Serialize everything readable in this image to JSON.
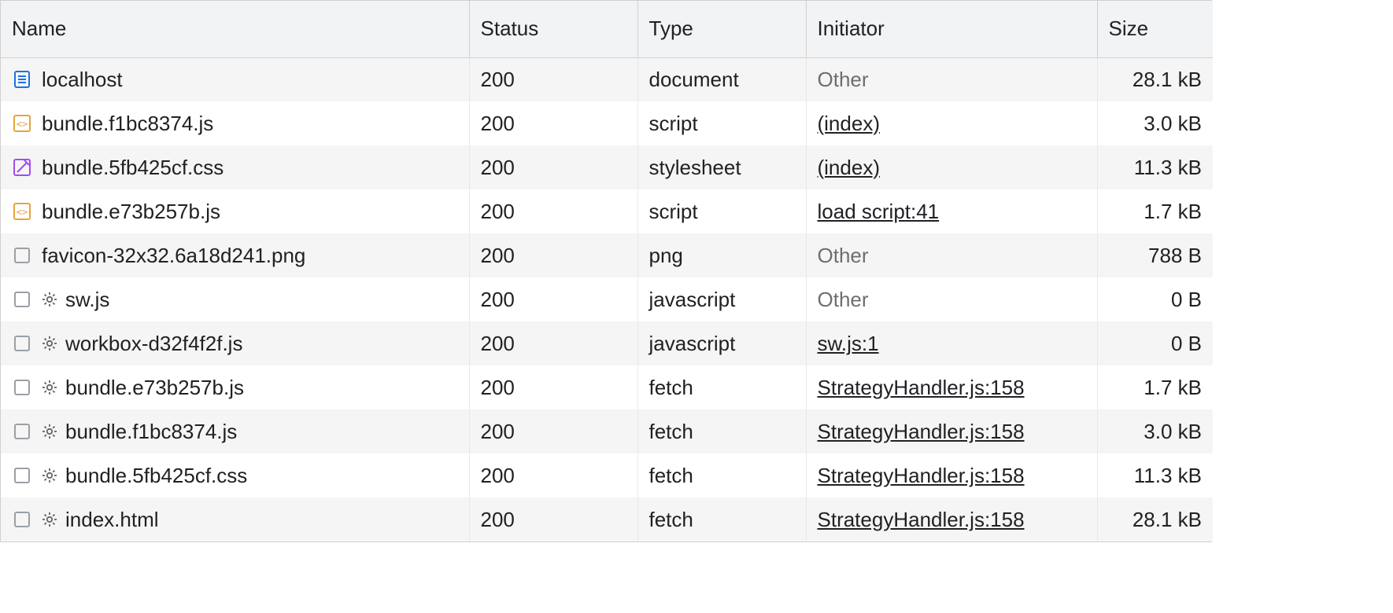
{
  "columns": {
    "name": "Name",
    "status": "Status",
    "type": "Type",
    "initiator": "Initiator",
    "size": "Size"
  },
  "rows": [
    {
      "icon": "document",
      "gear": false,
      "name": "localhost",
      "status": "200",
      "type": "document",
      "initiator": "Other",
      "initiator_link": false,
      "size": "28.1 kB"
    },
    {
      "icon": "js",
      "gear": false,
      "name": "bundle.f1bc8374.js",
      "status": "200",
      "type": "script",
      "initiator": "(index)",
      "initiator_link": true,
      "size": "3.0 kB"
    },
    {
      "icon": "css",
      "gear": false,
      "name": "bundle.5fb425cf.css",
      "status": "200",
      "type": "stylesheet",
      "initiator": "(index)",
      "initiator_link": true,
      "size": "11.3 kB"
    },
    {
      "icon": "js",
      "gear": false,
      "name": "bundle.e73b257b.js",
      "status": "200",
      "type": "script",
      "initiator": "load script:41",
      "initiator_link": true,
      "size": "1.7 kB"
    },
    {
      "icon": "generic",
      "gear": false,
      "name": "favicon-32x32.6a18d241.png",
      "status": "200",
      "type": "png",
      "initiator": "Other",
      "initiator_link": false,
      "size": "788 B"
    },
    {
      "icon": "generic",
      "gear": true,
      "name": "sw.js",
      "status": "200",
      "type": "javascript",
      "initiator": "Other",
      "initiator_link": false,
      "size": "0 B"
    },
    {
      "icon": "generic",
      "gear": true,
      "name": "workbox-d32f4f2f.js",
      "status": "200",
      "type": "javascript",
      "initiator": "sw.js:1",
      "initiator_link": true,
      "size": "0 B"
    },
    {
      "icon": "generic",
      "gear": true,
      "name": "bundle.e73b257b.js",
      "status": "200",
      "type": "fetch",
      "initiator": "StrategyHandler.js:158",
      "initiator_link": true,
      "size": "1.7 kB"
    },
    {
      "icon": "generic",
      "gear": true,
      "name": "bundle.f1bc8374.js",
      "status": "200",
      "type": "fetch",
      "initiator": "StrategyHandler.js:158",
      "initiator_link": true,
      "size": "3.0 kB"
    },
    {
      "icon": "generic",
      "gear": true,
      "name": "bundle.5fb425cf.css",
      "status": "200",
      "type": "fetch",
      "initiator": "StrategyHandler.js:158",
      "initiator_link": true,
      "size": "11.3 kB"
    },
    {
      "icon": "generic",
      "gear": true,
      "name": "index.html",
      "status": "200",
      "type": "fetch",
      "initiator": "StrategyHandler.js:158",
      "initiator_link": true,
      "size": "28.1 kB"
    }
  ]
}
